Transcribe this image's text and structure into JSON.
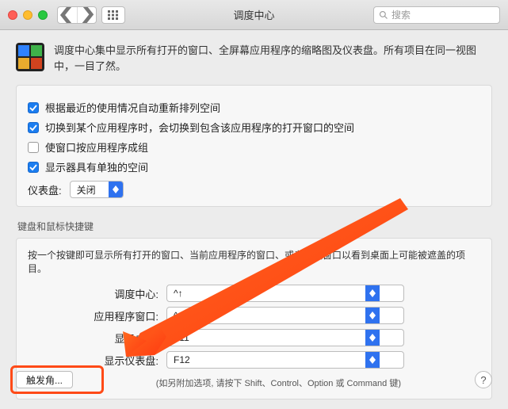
{
  "window": {
    "title": "调度中心",
    "search_placeholder": "搜索"
  },
  "intro": "调度中心集中显示所有打开的窗口、全屏幕应用程序的缩略图及仪表盘。所有项目在同一视图中，一目了然。",
  "checks": [
    {
      "label": "根据最近的使用情况自动重新排列空间",
      "on": true
    },
    {
      "label": "切换到某个应用程序时，会切换到包含该应用程序的打开窗口的空间",
      "on": true
    },
    {
      "label": "使窗口按应用程序成组",
      "on": false
    },
    {
      "label": "显示器具有单独的空间",
      "on": true
    }
  ],
  "dashboard": {
    "label": "仪表盘:",
    "value": "关闭"
  },
  "shortcuts_section": {
    "title": "键盘和鼠标快捷键",
    "desc": "按一个按键即可显示所有打开的窗口、当前应用程序的窗口、或者隐藏窗口以看到桌面上可能被遮盖的项目。",
    "rows": [
      {
        "label": "调度中心:",
        "value": "^↑"
      },
      {
        "label": "应用程序窗口:",
        "value": "^↓"
      },
      {
        "label": "显示桌面:",
        "value": "F11"
      },
      {
        "label": "显示仪表盘:",
        "value": "F12"
      }
    ],
    "hint": "(如另附加选项, 请按下 Shift、Control、Option 或 Command 键)"
  },
  "footer": {
    "hot_corners": "触发角...",
    "help": "?"
  }
}
